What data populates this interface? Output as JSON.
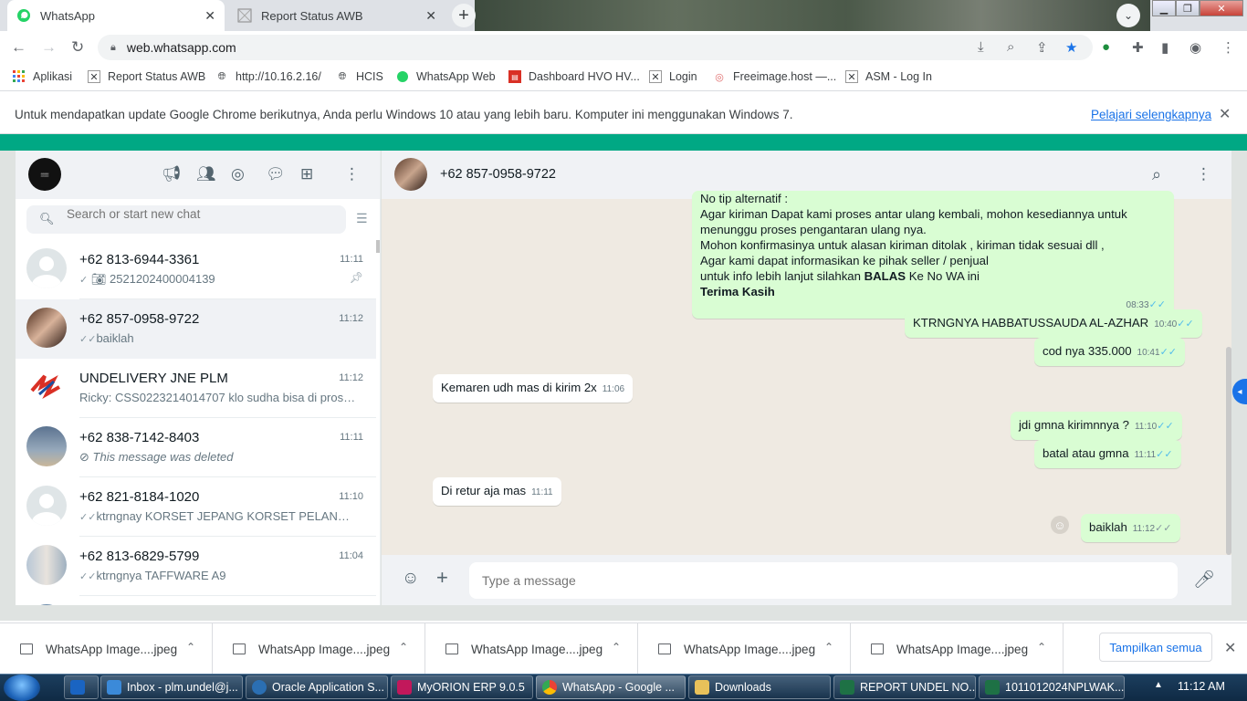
{
  "browser": {
    "tabs": [
      {
        "title": "WhatsApp",
        "active": true
      },
      {
        "title": "Report Status AWB",
        "active": false
      }
    ],
    "url": "web.whatsapp.com",
    "bookmarks": [
      "Aplikasi",
      "Report Status AWB",
      "http://10.16.2.16/",
      "HCIS",
      "WhatsApp Web",
      "Dashboard HVO HV...",
      "Login",
      "Freeimage.host —...",
      "ASM - Log In"
    ],
    "infobar": {
      "text": "Untuk mendapatkan update Google Chrome berikutnya, Anda perlu Windows 10 atau yang lebih baru. Komputer ini menggunakan Windows 7.",
      "link": "Pelajari selengkapnya"
    }
  },
  "sidebar": {
    "search_placeholder": "Search or start new chat",
    "chats": [
      {
        "name": "+62 813-6944-3361",
        "time": "11:11",
        "preview": "2521202400004139",
        "tick": "grey",
        "photo": true,
        "pinned": true,
        "selected": false
      },
      {
        "name": "+62 857-0958-9722",
        "time": "11:12",
        "preview": "baiklah",
        "tick": "grey2",
        "selected": true
      },
      {
        "name": "UNDELIVERY JNE PLM",
        "time": "11:12",
        "preview": "Ricky: CSS0223214014707 klo sudha bisa di proses w...",
        "selected": false
      },
      {
        "name": "+62 838-7142-8403",
        "time": "11:11",
        "preview": "This message was deleted",
        "deleted": true,
        "selected": false
      },
      {
        "name": "+62 821-8184-1020",
        "time": "11:10",
        "preview": "ktrngnay KORSET JEPANG KORSET PELANGSING T...",
        "tick": "grey2",
        "selected": false
      },
      {
        "name": "+62 813-6829-5799",
        "time": "11:04",
        "preview": "ktrngnya TAFFWARE A9",
        "tick": "grey2",
        "selected": false
      }
    ]
  },
  "conversation": {
    "contact": "+62 857-0958-9722",
    "composer_placeholder": "Type a message",
    "big_message": {
      "lines": [
        "No tip alternatif :",
        "Agar kiriman Dapat kami proses antar ulang kembali, mohon kesediannya untuk",
        "menunggu proses pengantaran ulang nya.",
        "Mohon konfirmasinya untuk alasan kiriman ditolak , kiriman tidak sesuai dll ,",
        "Agar kami dapat informasikan ke pihak seller / penjual"
      ],
      "line_pre": "untuk info lebih lanjut silahkan ",
      "line_bold": "BALAS",
      "line_post": " Ke No WA ini",
      "closing": "Terima Kasih",
      "time": "08:33"
    },
    "messages": [
      {
        "text": "KTRNGNYA HABBATUSSAUDA AL-AZHAR",
        "time": "10:40",
        "dir": "out"
      },
      {
        "text": "cod nya 335.000",
        "time": "10:41",
        "dir": "out"
      },
      {
        "text": "Kemaren udh mas di kirim 2x",
        "time": "11:06",
        "dir": "in"
      },
      {
        "text": "jdi gmna kirimnnya ?",
        "time": "11:10",
        "dir": "out"
      },
      {
        "text": "batal atau gmna",
        "time": "11:11",
        "dir": "out"
      },
      {
        "text": "Di retur aja mas",
        "time": "11:11",
        "dir": "in"
      },
      {
        "text": "baiklah",
        "time": "11:12",
        "dir": "out"
      }
    ]
  },
  "downloads": {
    "items": [
      "WhatsApp Image....jpeg",
      "WhatsApp Image....jpeg",
      "WhatsApp Image....jpeg",
      "WhatsApp Image....jpeg",
      "WhatsApp Image....jpeg"
    ],
    "show_all": "Tampilkan semua"
  },
  "taskbar": {
    "items": [
      "Inbox - plm.undel@j...",
      "Oracle Application S...",
      "MyORION ERP 9.0.5",
      "WhatsApp - Google ...",
      "Downloads",
      "REPORT UNDEL NO...",
      "1011012024NPLWAK..."
    ],
    "clock": "11:12 AM"
  }
}
